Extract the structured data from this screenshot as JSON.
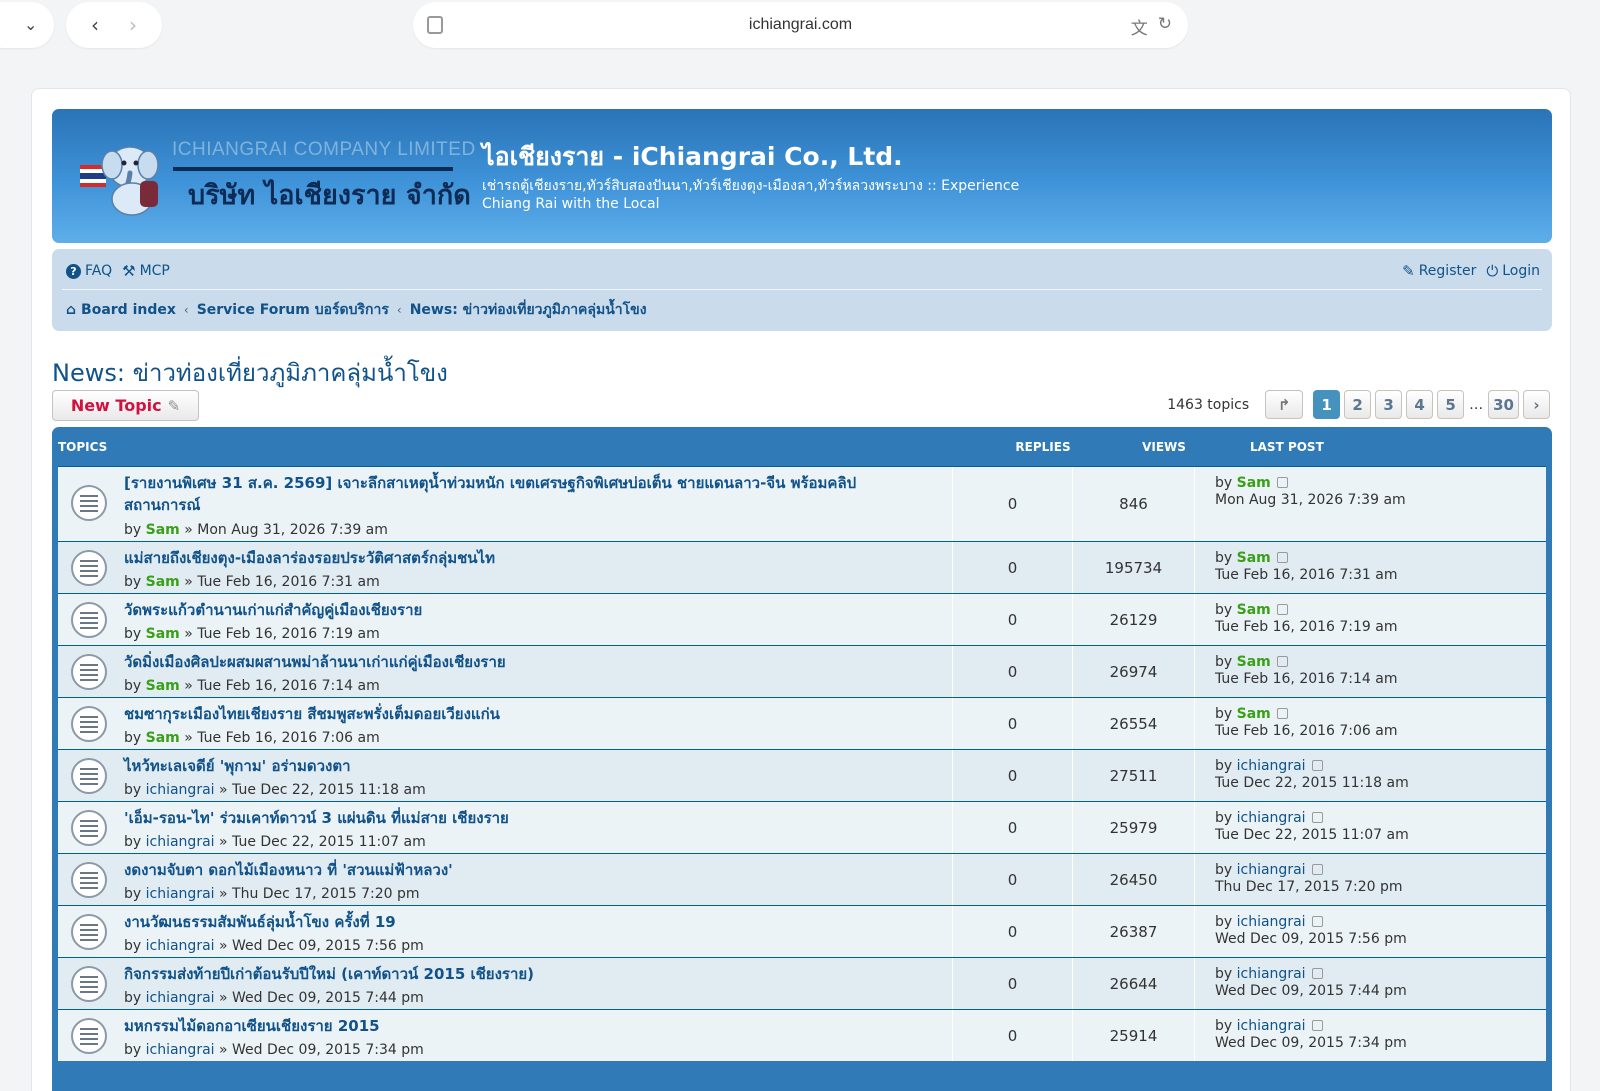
{
  "browser": {
    "url": "ichiangrai.com"
  },
  "header": {
    "logo_en": "ICHIANGRAI COMPANY LIMITED",
    "logo_th": "บริษัท ไอเชียงราย จำกัด",
    "site_title": "ไอเชียงราย - iChiangrai Co., Ltd.",
    "site_description": "เช่ารถตู้เชียงราย,ทัวร์สิบสองปันนา,ทัวร์เชียงตุง-เมืองลา,ทัวร์หลวงพระบาง :: Experience Chiang Rai with the Local"
  },
  "nav": {
    "faq": "FAQ",
    "mcp": "MCP",
    "register": "Register",
    "login": "Login",
    "breadcrumb": [
      "Board index",
      "Service Forum บอร์ดบริการ",
      "News: ข่าวท่องเที่ยวภูมิภาคลุ่มน้ำโขง"
    ]
  },
  "forum": {
    "title": "News: ข่าวท่องเที่ยวภูมิภาคลุ่มน้ำโขง",
    "new_topic_label": "New Topic",
    "topic_count": "1463 topics",
    "pages": [
      "1",
      "2",
      "3",
      "4",
      "5",
      "30"
    ],
    "ellipsis": "…",
    "active_page": "1"
  },
  "table": {
    "headers": {
      "topics": "TOPICS",
      "replies": "REPLIES",
      "views": "VIEWS",
      "last_post": "LAST POST"
    },
    "rows": [
      {
        "title": "[รายงานพิเศษ 31 ส.ค. 2569] เจาะลึกสาเหตุน้ำท่วมหนัก เขตเศรษฐกิจพิเศษบ่อเต็น ชายแดนลาว-จีน พร้อมคลิปสถานการณ์",
        "by": "by",
        "author": "Sam",
        "sep": "»",
        "date": "Mon Aug 31, 2026 7:39 am",
        "replies": "0",
        "views": "846",
        "last_author": "Sam",
        "last_date": "Mon Aug 31, 2026 7:39 am"
      },
      {
        "title": "แม่สายถึงเชียงตุง-เมืองลาร่องรอยประวัติศาสตร์กลุ่มชนไท",
        "by": "by",
        "author": "Sam",
        "sep": "»",
        "date": "Tue Feb 16, 2016 7:31 am",
        "replies": "0",
        "views": "195734",
        "last_author": "Sam",
        "last_date": "Tue Feb 16, 2016 7:31 am"
      },
      {
        "title": "วัดพระแก้วตำนานเก่าแก่สำคัญคู่เมืองเชียงราย",
        "by": "by",
        "author": "Sam",
        "sep": "»",
        "date": "Tue Feb 16, 2016 7:19 am",
        "replies": "0",
        "views": "26129",
        "last_author": "Sam",
        "last_date": "Tue Feb 16, 2016 7:19 am"
      },
      {
        "title": "วัดมิ่งเมืองศิลปะผสมผสานพม่าล้านนาเก่าแก่คู่เมืองเชียงราย",
        "by": "by",
        "author": "Sam",
        "sep": "»",
        "date": "Tue Feb 16, 2016 7:14 am",
        "replies": "0",
        "views": "26974",
        "last_author": "Sam",
        "last_date": "Tue Feb 16, 2016 7:14 am"
      },
      {
        "title": "ชมซากุระเมืองไทยเชียงราย สีชมพูสะพรั่งเต็มดอยเวียงแก่น",
        "by": "by",
        "author": "Sam",
        "sep": "»",
        "date": "Tue Feb 16, 2016 7:06 am",
        "replies": "0",
        "views": "26554",
        "last_author": "Sam",
        "last_date": "Tue Feb 16, 2016 7:06 am"
      },
      {
        "title": "ไหว้ทะเลเจดีย์ 'พุกาม' อร่ามดวงตา",
        "by": "by",
        "author": "ichiangrai",
        "sep": "»",
        "date": "Tue Dec 22, 2015 11:18 am",
        "replies": "0",
        "views": "27511",
        "last_author": "ichiangrai",
        "last_date": "Tue Dec 22, 2015 11:18 am"
      },
      {
        "title": "'เอ็ม-รอน-ไท' ร่วมเคาท์ดาวน์ 3 แผ่นดิน ที่แม่สาย เชียงราย",
        "by": "by",
        "author": "ichiangrai",
        "sep": "»",
        "date": "Tue Dec 22, 2015 11:07 am",
        "replies": "0",
        "views": "25979",
        "last_author": "ichiangrai",
        "last_date": "Tue Dec 22, 2015 11:07 am"
      },
      {
        "title": "งดงามจับตา ดอกไม้เมืองหนาว ที่ 'สวนแม่ฟ้าหลวง'",
        "by": "by",
        "author": "ichiangrai",
        "sep": "»",
        "date": "Thu Dec 17, 2015 7:20 pm",
        "replies": "0",
        "views": "26450",
        "last_author": "ichiangrai",
        "last_date": "Thu Dec 17, 2015 7:20 pm"
      },
      {
        "title": "งานวัฒนธรรมสัมพันธ์ลุ่มน้ำโขง ครั้งที่ 19",
        "by": "by",
        "author": "ichiangrai",
        "sep": "»",
        "date": "Wed Dec 09, 2015 7:56 pm",
        "replies": "0",
        "views": "26387",
        "last_author": "ichiangrai",
        "last_date": "Wed Dec 09, 2015 7:56 pm"
      },
      {
        "title": "กิจกรรมส่งท้ายปีเก่าต้อนรับปีใหม่ (เคาท์ดาวน์ 2015 เชียงราย)",
        "by": "by",
        "author": "ichiangrai",
        "sep": "»",
        "date": "Wed Dec 09, 2015 7:44 pm",
        "replies": "0",
        "views": "26644",
        "last_author": "ichiangrai",
        "last_date": "Wed Dec 09, 2015 7:44 pm"
      },
      {
        "title": "มหกรรมไม้ดอกอาเซียนเชียงราย 2015",
        "by": "by",
        "author": "ichiangrai",
        "sep": "»",
        "date": "Wed Dec 09, 2015 7:34 pm",
        "replies": "0",
        "views": "25914",
        "last_author": "ichiangrai",
        "last_date": "Wed Dec 09, 2015 7:34 pm"
      }
    ]
  },
  "colors": {
    "link": "#105289",
    "accent_red": "#d31141",
    "author_green": "#3aa018",
    "table_header": "#2f7ab7"
  }
}
